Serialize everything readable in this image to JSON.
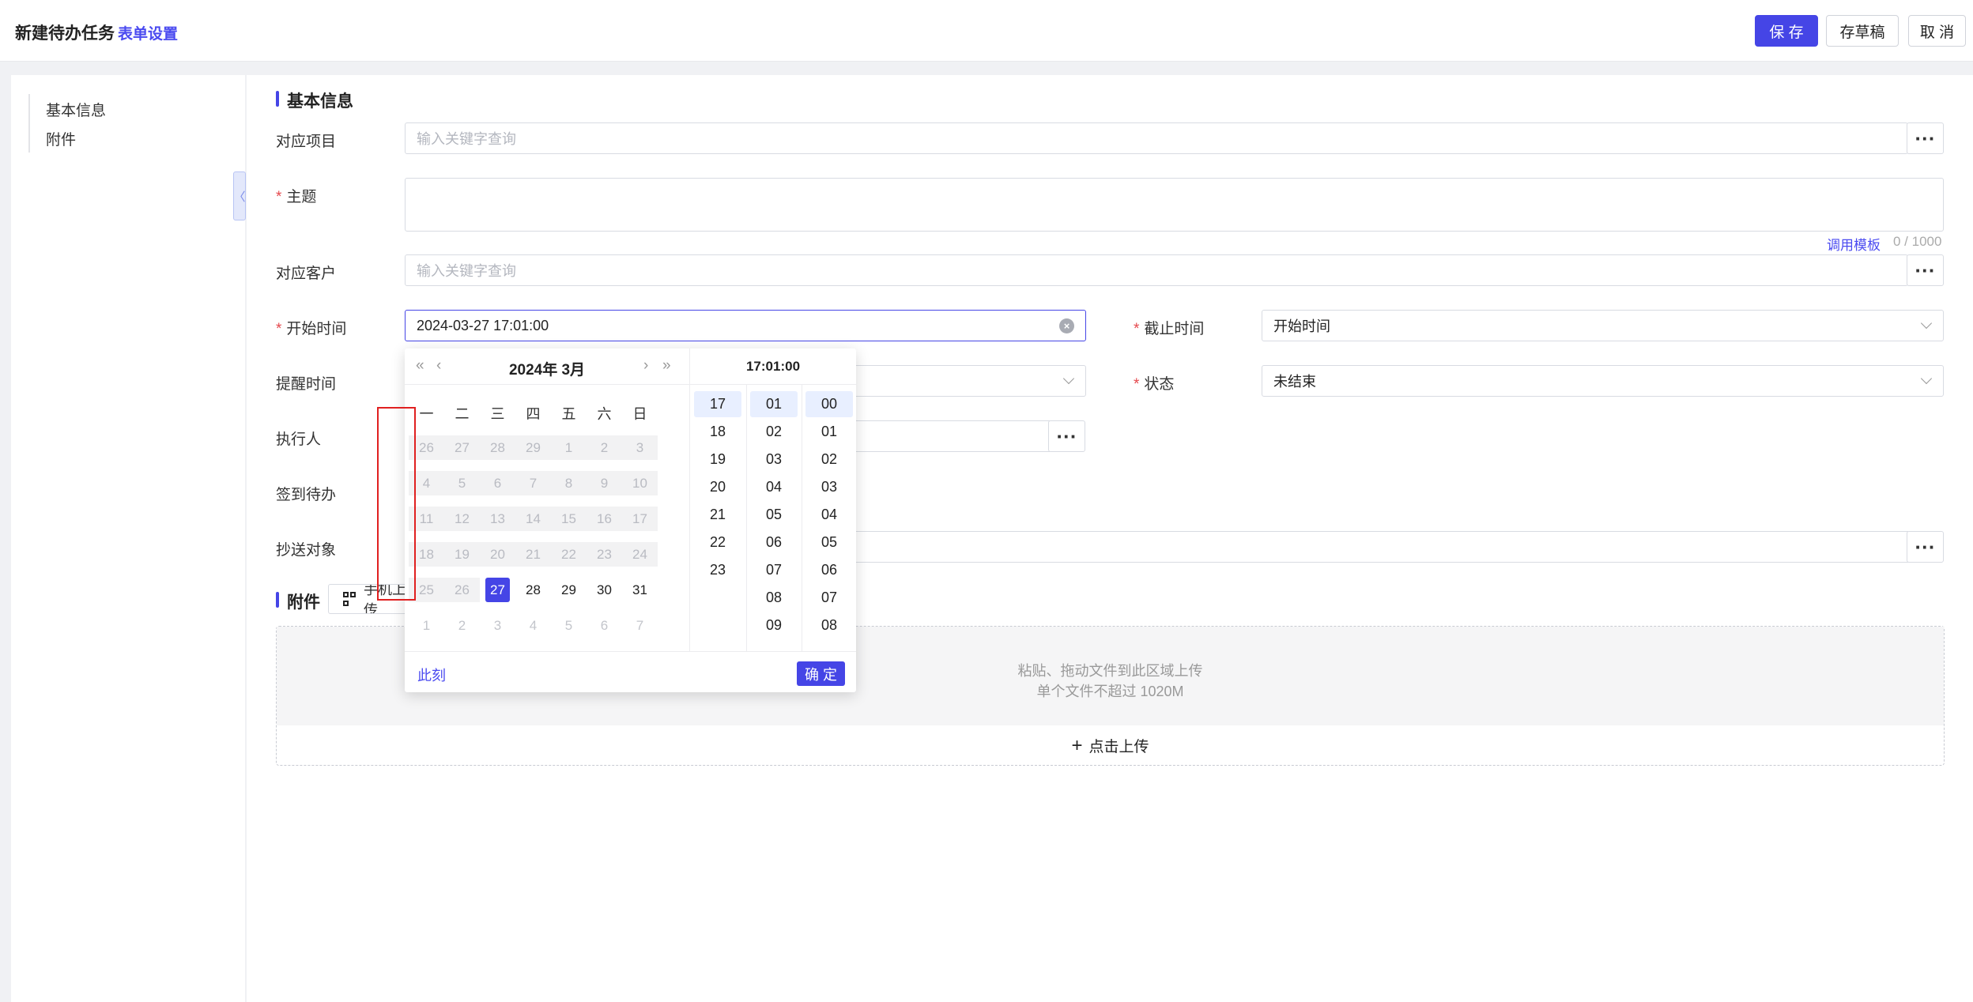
{
  "header": {
    "title": "新建待办任务",
    "settings_link": "表单设置",
    "save_label": "保 存",
    "draft_label": "存草稿",
    "cancel_label": "取 消",
    "accent_color": "#4545e6"
  },
  "sidebar": {
    "items": [
      {
        "label": "基本信息"
      },
      {
        "label": "附件"
      }
    ]
  },
  "form": {
    "section_basic": "基本信息",
    "project": {
      "label": "对应项目",
      "placeholder": "输入关键字查询"
    },
    "subject": {
      "label": "主题",
      "required": true,
      "template_link": "调用模板",
      "counter": "0 / 1000"
    },
    "customer": {
      "label": "对应客户",
      "placeholder": "输入关键字查询"
    },
    "start_time": {
      "label": "开始时间",
      "required": true,
      "value": "2024-03-27 17:01:00"
    },
    "end_time": {
      "label": "截止时间",
      "required": true,
      "value": "开始时间"
    },
    "reminder": {
      "label": "提醒时间"
    },
    "status": {
      "label": "状态",
      "required": true,
      "value": "未结束"
    },
    "executor": {
      "label": "执行人"
    },
    "checkin": {
      "label": "签到待办"
    },
    "cc": {
      "label": "抄送对象"
    },
    "section_attach": "附件",
    "mobile_upload_label": "手机上传",
    "upload_hint_1": "粘贴、拖动文件到此区域上传",
    "upload_hint_2": "单个文件不超过 1020M",
    "upload_button": "点击上传"
  },
  "datepicker": {
    "month_title": "2024年  3月",
    "time_title": "17:01:00",
    "weekdays": [
      "一",
      "二",
      "三",
      "四",
      "五",
      "六",
      "日"
    ],
    "weeks": [
      [
        "26",
        "27",
        "28",
        "29",
        "1",
        "2",
        "3"
      ],
      [
        "4",
        "5",
        "6",
        "7",
        "8",
        "9",
        "10"
      ],
      [
        "11",
        "12",
        "13",
        "14",
        "15",
        "16",
        "17"
      ],
      [
        "18",
        "19",
        "20",
        "21",
        "22",
        "23",
        "24"
      ],
      [
        "25",
        "26",
        "27",
        "28",
        "29",
        "30",
        "31"
      ],
      [
        "1",
        "2",
        "3",
        "4",
        "5",
        "6",
        "7"
      ]
    ],
    "selected_day": "27",
    "hours": [
      "17",
      "18",
      "19",
      "20",
      "21",
      "22",
      "23"
    ],
    "minutes": [
      "01",
      "02",
      "03",
      "04",
      "05",
      "06",
      "07",
      "08",
      "09"
    ],
    "seconds": [
      "00",
      "01",
      "02",
      "03",
      "04",
      "05",
      "06",
      "07",
      "08"
    ],
    "now_label": "此刻",
    "ok_label": "确 定"
  }
}
